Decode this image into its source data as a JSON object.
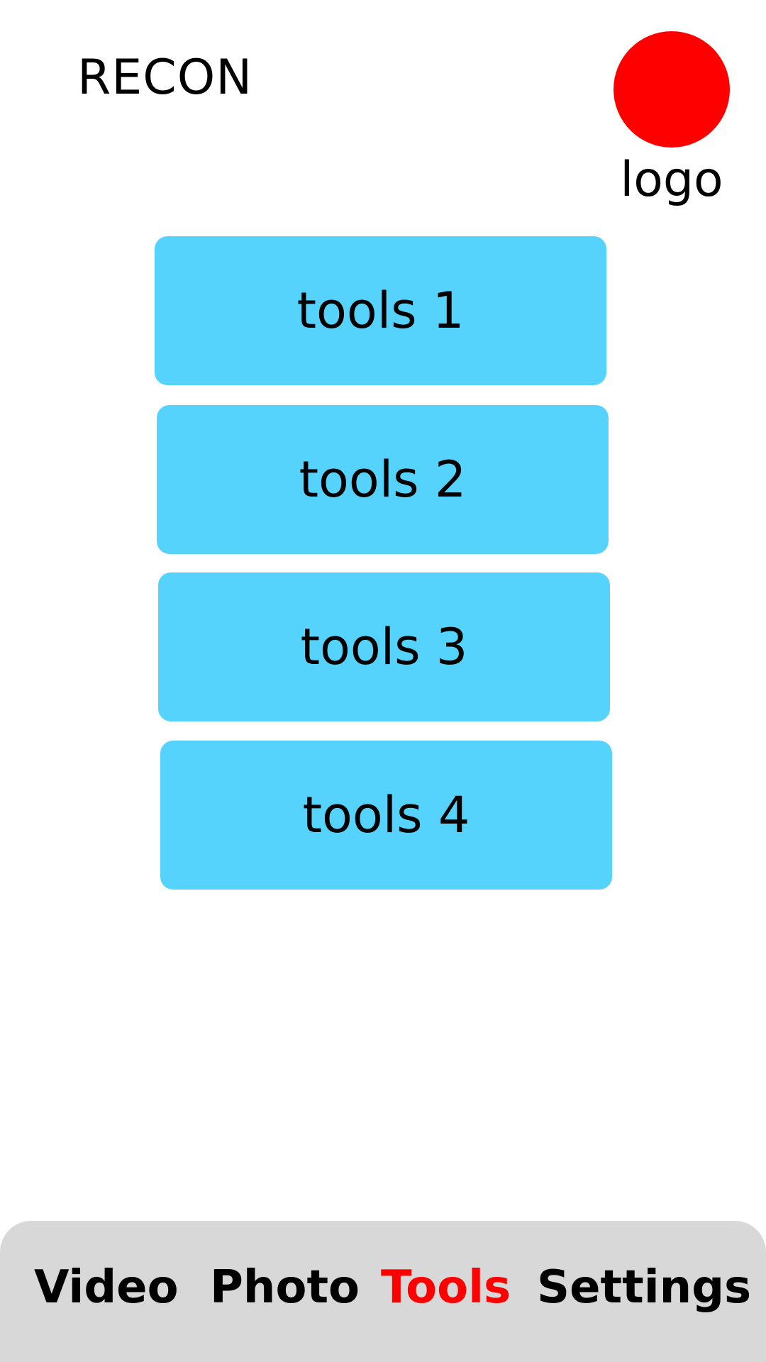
{
  "header": {
    "title": "RECON",
    "logo_label": "logo",
    "logo_color": "#ff0000"
  },
  "tools": [
    {
      "label": "tools 1"
    },
    {
      "label": "tools 2"
    },
    {
      "label": "tools 3"
    },
    {
      "label": "tools 4"
    }
  ],
  "tool_button_color": "#56d3fd",
  "bottom_nav": {
    "items": [
      {
        "label": "Video",
        "active": false
      },
      {
        "label": "Photo",
        "active": false
      },
      {
        "label": "Tools",
        "active": true
      },
      {
        "label": "Settings",
        "active": false
      }
    ],
    "background_color": "#d8d8d8",
    "active_color": "#ff0000"
  }
}
